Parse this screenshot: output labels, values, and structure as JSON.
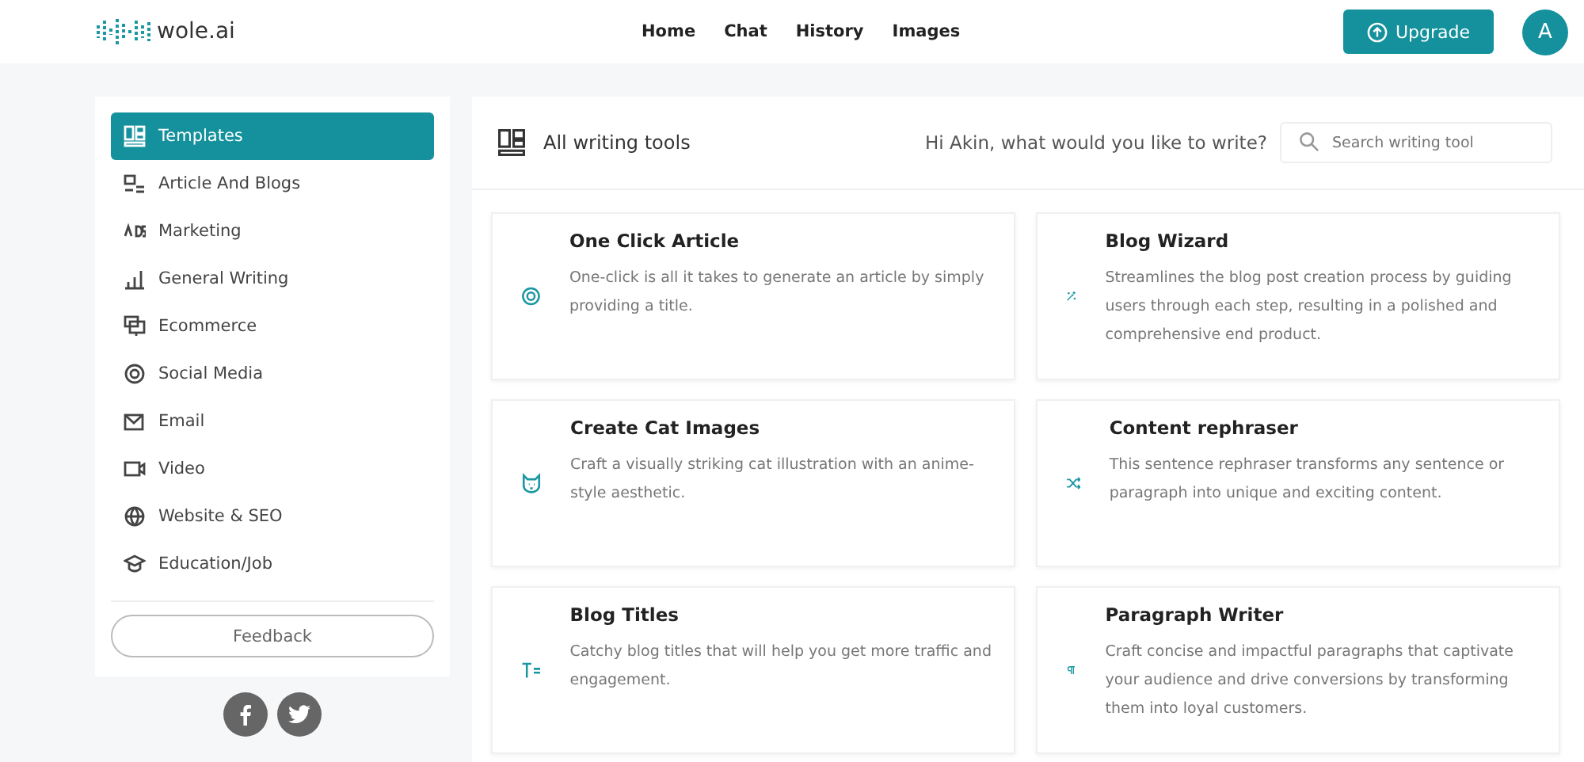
{
  "header": {
    "logo": "wole.ai",
    "nav": [
      "Home",
      "Chat",
      "History",
      "Images"
    ],
    "upgrade": "Upgrade",
    "avatar": "A"
  },
  "sidebar": {
    "items": [
      {
        "label": "Templates",
        "selected": true
      },
      {
        "label": "Article And Blogs",
        "selected": false
      },
      {
        "label": "Marketing",
        "selected": false
      },
      {
        "label": "General Writing",
        "selected": false
      },
      {
        "label": "Ecommerce",
        "selected": false
      },
      {
        "label": "Social Media",
        "selected": false
      },
      {
        "label": "Email",
        "selected": false
      },
      {
        "label": "Video",
        "selected": false
      },
      {
        "label": "Website & SEO",
        "selected": false
      },
      {
        "label": "Education/Job",
        "selected": false
      }
    ],
    "feedback": "Feedback"
  },
  "main": {
    "title": "All writing tools",
    "greeting": "Hi Akin, what would you like to write?",
    "search": {
      "placeholder": "Search writing tool"
    },
    "cards": [
      {
        "title": "One Click Article",
        "description": "One-click is all it takes to generate an article by simply providing a title."
      },
      {
        "title": "Blog Wizard",
        "description": "Streamlines the blog post creation process by guiding users through each step, resulting in a polished and comprehensive end product."
      },
      {
        "title": "Create Cat Images",
        "description": "Craft a visually striking cat illustration with an anime-style aesthetic."
      },
      {
        "title": "Content rephraser",
        "description": "This sentence rephraser transforms any sentence or paragraph into unique and exciting content."
      },
      {
        "title": "Blog Titles",
        "description": "Catchy blog titles that will help you get more traffic and engagement."
      },
      {
        "title": "Paragraph Writer",
        "description": "Craft concise and impactful paragraphs that captivate your audience and drive conversions by transforming them into loyal customers."
      }
    ]
  }
}
